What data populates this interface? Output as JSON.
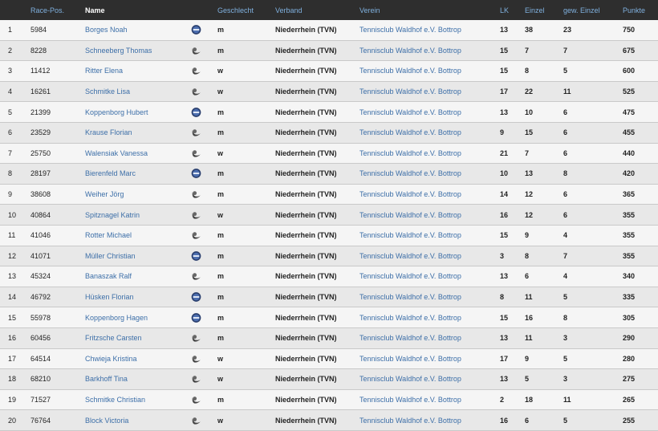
{
  "header": {
    "col_pos": "",
    "race_pos": "Race-Pos.",
    "name": "Name",
    "gender": "Geschlecht",
    "verband": "Verband",
    "verein": "Verein",
    "lk": "LK",
    "einzel": "Einzel",
    "gew_einzel": "gew. Einzel",
    "punkte": "Punkte"
  },
  "colors": {
    "header_bg": "#2e2e2e",
    "header_link": "#7fb0de",
    "row_odd": "#f5f5f5",
    "row_even": "#e8e8e8",
    "link": "#3d6fa8"
  },
  "rows": [
    {
      "pos": "1",
      "race": "5984",
      "name": "Borges Noah",
      "icon": "flag-badge-icon",
      "gender": "m",
      "verband": "Niederrhein (TVN)",
      "verein": "Tennisclub Waldhof e.V. Bottrop",
      "lk": "13",
      "einzel": "38",
      "gew": "23",
      "punkte": "750"
    },
    {
      "pos": "2",
      "race": "8228",
      "name": "Schneeberg Thomas",
      "icon": "swoosh-icon",
      "gender": "m",
      "verband": "Niederrhein (TVN)",
      "verein": "Tennisclub Waldhof e.V. Bottrop",
      "lk": "15",
      "einzel": "7",
      "gew": "7",
      "punkte": "675"
    },
    {
      "pos": "3",
      "race": "11412",
      "name": "Ritter Elena",
      "icon": "swoosh-icon",
      "gender": "w",
      "verband": "Niederrhein (TVN)",
      "verein": "Tennisclub Waldhof e.V. Bottrop",
      "lk": "15",
      "einzel": "8",
      "gew": "5",
      "punkte": "600"
    },
    {
      "pos": "4",
      "race": "16261",
      "name": "Schmitke Lisa",
      "icon": "swoosh-icon",
      "gender": "w",
      "verband": "Niederrhein (TVN)",
      "verein": "Tennisclub Waldhof e.V. Bottrop",
      "lk": "17",
      "einzel": "22",
      "gew": "11",
      "punkte": "525"
    },
    {
      "pos": "5",
      "race": "21399",
      "name": "Koppenborg Hubert",
      "icon": "flag-badge-icon",
      "gender": "m",
      "verband": "Niederrhein (TVN)",
      "verein": "Tennisclub Waldhof e.V. Bottrop",
      "lk": "13",
      "einzel": "10",
      "gew": "6",
      "punkte": "475"
    },
    {
      "pos": "6",
      "race": "23529",
      "name": "Krause Florian",
      "icon": "swoosh-icon",
      "gender": "m",
      "verband": "Niederrhein (TVN)",
      "verein": "Tennisclub Waldhof e.V. Bottrop",
      "lk": "9",
      "einzel": "15",
      "gew": "6",
      "punkte": "455"
    },
    {
      "pos": "7",
      "race": "25750",
      "name": "Walensiak Vanessa",
      "icon": "swoosh-icon",
      "gender": "w",
      "verband": "Niederrhein (TVN)",
      "verein": "Tennisclub Waldhof e.V. Bottrop",
      "lk": "21",
      "einzel": "7",
      "gew": "6",
      "punkte": "440"
    },
    {
      "pos": "8",
      "race": "28197",
      "name": "Bierenfeld Marc",
      "icon": "flag-badge-icon",
      "gender": "m",
      "verband": "Niederrhein (TVN)",
      "verein": "Tennisclub Waldhof e.V. Bottrop",
      "lk": "10",
      "einzel": "13",
      "gew": "8",
      "punkte": "420"
    },
    {
      "pos": "9",
      "race": "38608",
      "name": "Weiher Jörg",
      "icon": "swoosh-icon",
      "gender": "m",
      "verband": "Niederrhein (TVN)",
      "verein": "Tennisclub Waldhof e.V. Bottrop",
      "lk": "14",
      "einzel": "12",
      "gew": "6",
      "punkte": "365"
    },
    {
      "pos": "10",
      "race": "40864",
      "name": "Spitznagel Katrin",
      "icon": "swoosh-icon",
      "gender": "w",
      "verband": "Niederrhein (TVN)",
      "verein": "Tennisclub Waldhof e.V. Bottrop",
      "lk": "16",
      "einzel": "12",
      "gew": "6",
      "punkte": "355"
    },
    {
      "pos": "11",
      "race": "41046",
      "name": "Rotter Michael",
      "icon": "swoosh-icon",
      "gender": "m",
      "verband": "Niederrhein (TVN)",
      "verein": "Tennisclub Waldhof e.V. Bottrop",
      "lk": "15",
      "einzel": "9",
      "gew": "4",
      "punkte": "355"
    },
    {
      "pos": "12",
      "race": "41071",
      "name": "Müller Christian",
      "icon": "flag-badge-icon",
      "gender": "m",
      "verband": "Niederrhein (TVN)",
      "verein": "Tennisclub Waldhof e.V. Bottrop",
      "lk": "3",
      "einzel": "8",
      "gew": "7",
      "punkte": "355"
    },
    {
      "pos": "13",
      "race": "45324",
      "name": "Banaszak Ralf",
      "icon": "swoosh-icon",
      "gender": "m",
      "verband": "Niederrhein (TVN)",
      "verein": "Tennisclub Waldhof e.V. Bottrop",
      "lk": "13",
      "einzel": "6",
      "gew": "4",
      "punkte": "340"
    },
    {
      "pos": "14",
      "race": "46792",
      "name": "Hüsken Florian",
      "icon": "flag-badge-icon",
      "gender": "m",
      "verband": "Niederrhein (TVN)",
      "verein": "Tennisclub Waldhof e.V. Bottrop",
      "lk": "8",
      "einzel": "11",
      "gew": "5",
      "punkte": "335"
    },
    {
      "pos": "15",
      "race": "55978",
      "name": "Koppenborg Hagen",
      "icon": "flag-badge-icon",
      "gender": "m",
      "verband": "Niederrhein (TVN)",
      "verein": "Tennisclub Waldhof e.V. Bottrop",
      "lk": "15",
      "einzel": "16",
      "gew": "8",
      "punkte": "305"
    },
    {
      "pos": "16",
      "race": "60456",
      "name": "Fritzsche Carsten",
      "icon": "swoosh-icon",
      "gender": "m",
      "verband": "Niederrhein (TVN)",
      "verein": "Tennisclub Waldhof e.V. Bottrop",
      "lk": "13",
      "einzel": "11",
      "gew": "3",
      "punkte": "290"
    },
    {
      "pos": "17",
      "race": "64514",
      "name": "Chwieja Kristina",
      "icon": "swoosh-icon",
      "gender": "w",
      "verband": "Niederrhein (TVN)",
      "verein": "Tennisclub Waldhof e.V. Bottrop",
      "lk": "17",
      "einzel": "9",
      "gew": "5",
      "punkte": "280"
    },
    {
      "pos": "18",
      "race": "68210",
      "name": "Barkhoff Tina",
      "icon": "swoosh-icon",
      "gender": "w",
      "verband": "Niederrhein (TVN)",
      "verein": "Tennisclub Waldhof e.V. Bottrop",
      "lk": "13",
      "einzel": "5",
      "gew": "3",
      "punkte": "275"
    },
    {
      "pos": "19",
      "race": "71527",
      "name": "Schmitke Christian",
      "icon": "swoosh-icon",
      "gender": "m",
      "verband": "Niederrhein (TVN)",
      "verein": "Tennisclub Waldhof e.V. Bottrop",
      "lk": "2",
      "einzel": "18",
      "gew": "11",
      "punkte": "265"
    },
    {
      "pos": "20",
      "race": "76764",
      "name": "Block Victoria",
      "icon": "swoosh-icon",
      "gender": "w",
      "verband": "Niederrhein (TVN)",
      "verein": "Tennisclub Waldhof e.V. Bottrop",
      "lk": "16",
      "einzel": "6",
      "gew": "5",
      "punkte": "255"
    }
  ]
}
